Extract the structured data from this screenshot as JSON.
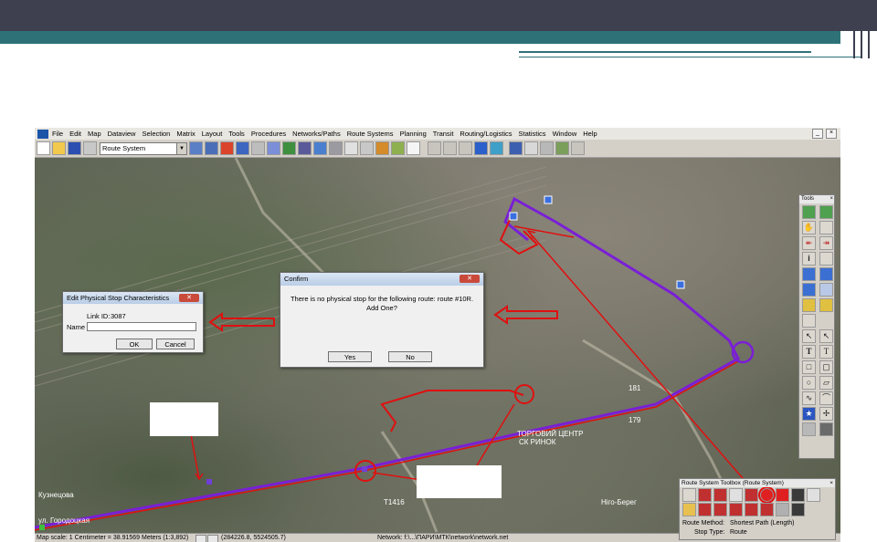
{
  "menu": {
    "items": [
      "File",
      "Edit",
      "Map",
      "Dataview",
      "Selection",
      "Matrix",
      "Layout",
      "Tools",
      "Procedures",
      "Networks/Paths",
      "Route Systems",
      "Planning",
      "Transit",
      "Routing/Logistics",
      "Statistics",
      "Window",
      "Help"
    ],
    "window_controls": [
      "_",
      "×"
    ]
  },
  "toolbar": {
    "layer_select": "Route System"
  },
  "status": {
    "scale": "Map scale: 1 Centimeter = 38.91569 Meters (1:3,892)",
    "coords": "(284226.8, 5524505.7)",
    "network": "Network: f:\\...\\ПАРИ\\МТК\\network\\network.net"
  },
  "edit_dialog": {
    "title": "Edit Physical Stop Characteristics",
    "link_id_label": "Link ID:",
    "link_id_value": "3087",
    "name_label": "Name",
    "name_value": "",
    "ok": "OK",
    "cancel": "Cancel"
  },
  "confirm_dialog": {
    "title": "Confirm",
    "message_line1": "There is no physical stop for the following route: route #10R.",
    "message_line2": "Add One?",
    "yes": "Yes",
    "no": "No"
  },
  "tools_panel": {
    "title": "Tools",
    "close": "×"
  },
  "route_toolbox": {
    "title": "Route System Toolbox (Route System)",
    "close": "×",
    "route_method_label": "Route Method:",
    "route_method_value": "Shortest Path (Length)",
    "stop_type_label": "Stop Type:",
    "stop_type_value": "Route"
  },
  "map_labels": {
    "kuznetsova": "Кузнецова",
    "gorodotskaya": "ул. Городоцкая",
    "trade_center": "ТОРГОВИЙ ЦЕНТР",
    "sk_rynok": "СК РИНОК",
    "nig_bereg": "Ніго-Берег",
    "num_t1416": "T1416",
    "num_179": "179",
    "num_181": "181"
  },
  "colors": {
    "route": "#7a1fd6",
    "annotation": "#e01010",
    "slide_dark": "#3e3f4f",
    "slide_teal": "#2e7278"
  }
}
